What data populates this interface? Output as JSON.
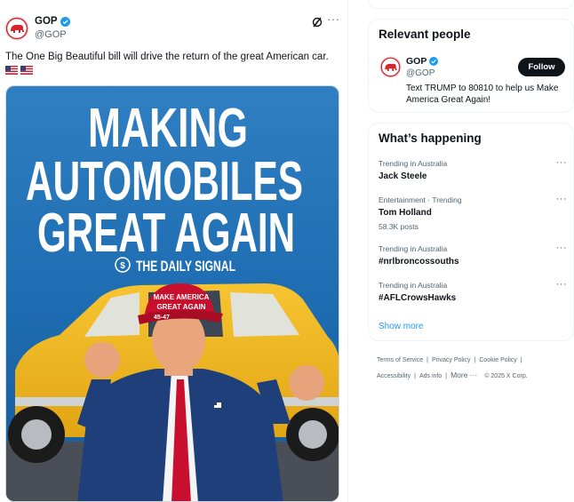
{
  "post": {
    "author_name": "GOP",
    "author_handle": "@GOP",
    "text": "The One Big Beautiful bill will drive the return of the great American car.",
    "flags": [
      "us-flag-icon",
      "us-flag-icon"
    ],
    "media": {
      "headline_lines": [
        "MAKING",
        "AUTOMOBILES",
        "GREAT AGAIN"
      ],
      "brand": "THE DAILY SIGNAL",
      "hat_text_1": "MAKE AMERICA",
      "hat_text_2": "GREAT AGAIN",
      "hat_side": "45-47"
    }
  },
  "relevant_people": {
    "title": "Relevant people",
    "name": "GOP",
    "handle": "@GOP",
    "follow_label": "Follow",
    "bio": "Text TRUMP to 80810 to help us Make America Great Again!"
  },
  "whats_happening": {
    "title": "What’s happening",
    "trends": [
      {
        "meta": "Trending in Australia",
        "name": "Jack Steele",
        "posts": ""
      },
      {
        "meta": "Entertainment · Trending",
        "name": "Tom Holland",
        "posts": "58.3K posts"
      },
      {
        "meta": "Trending in Australia",
        "name": "#nrlbroncossouths",
        "posts": ""
      },
      {
        "meta": "Trending in Australia",
        "name": "#AFLCrowsHawks",
        "posts": ""
      }
    ],
    "show_more": "Show more"
  },
  "footer": {
    "terms": "Terms of Service",
    "privacy": "Privacy Policy",
    "cookie": "Cookie Policy",
    "accessibility": "Accessibility",
    "ads": "Ads info",
    "more": "More ···",
    "copyright": "© 2025 X Corp."
  },
  "colors": {
    "accent": "#1d9bf0",
    "follow_bg": "#0f1419",
    "verified": "#1d9bf0",
    "gop_red": "#d7262e"
  }
}
